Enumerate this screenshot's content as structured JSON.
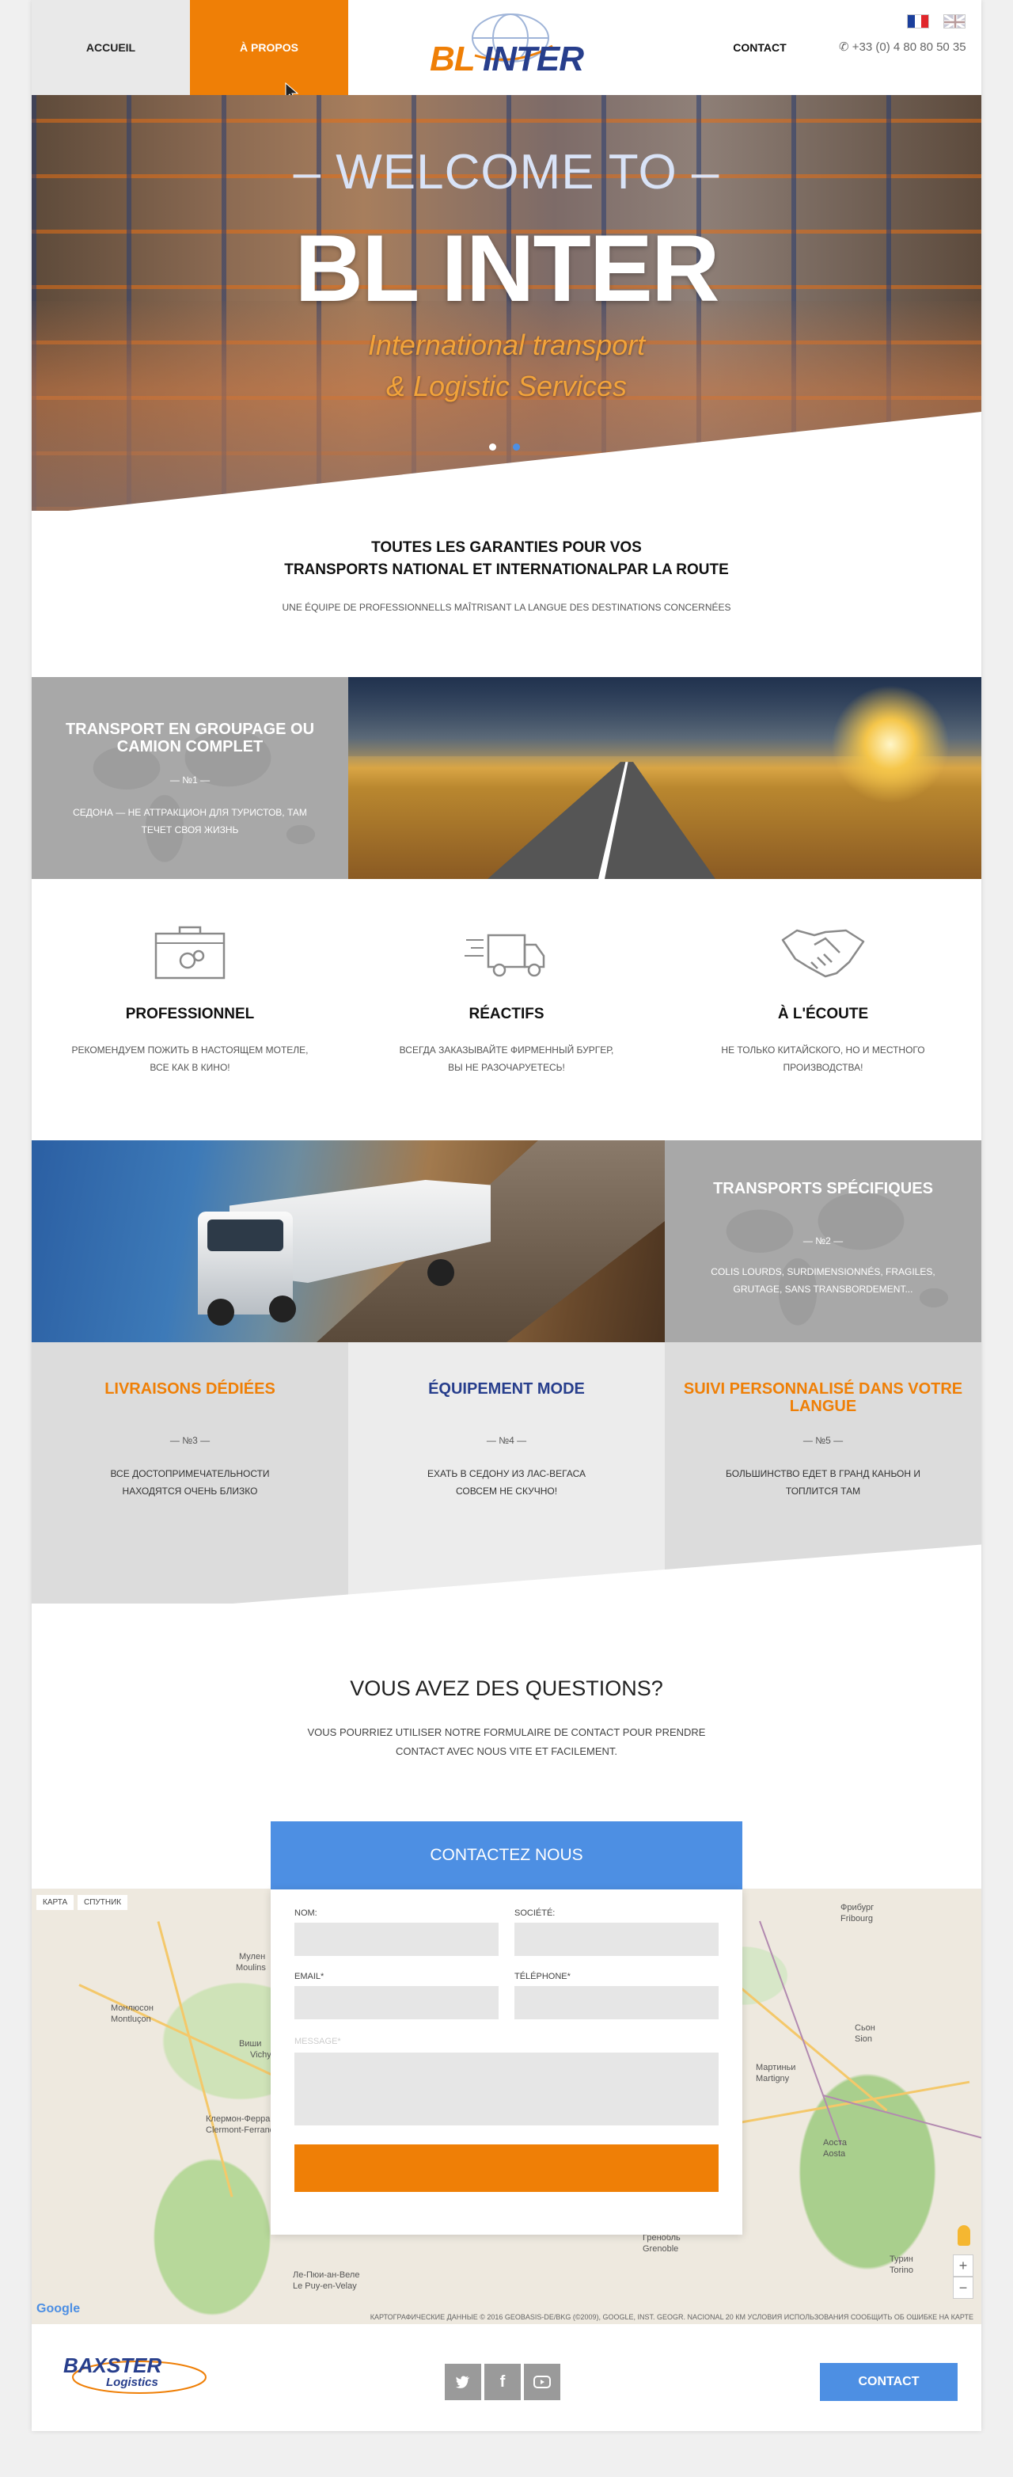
{
  "header": {
    "nav": [
      {
        "label": "ACCUEIL"
      },
      {
        "label": "À PROPOS"
      },
      {
        "label": "CONTACT"
      }
    ],
    "logo": {
      "part1": "BL",
      "part2": "INTER"
    },
    "phone": "+33 (0) 4 80 80 50 35",
    "languages": [
      "fr-flag-icon",
      "en-flag-icon"
    ]
  },
  "hero": {
    "welcome": "– WELCOME TO –",
    "title": "BL INTER",
    "subtitle_line1": "International transport",
    "subtitle_line2": "& Logistic Services",
    "slide_count": 2,
    "active_slide": 1
  },
  "intro": {
    "title_line1": "TOUTES LES GARANTIES POUR VOS",
    "title_line2": "TRANSPORTS  NATIONAL ET INTERNATIONALPAR LA ROUTE",
    "subtitle": "UNE ÉQUIPE DE PROFESSIONNELLS MAÎTRISANT LA LANGUE DES DESTINATIONS CONCERNÉES"
  },
  "services": [
    {
      "title": "TRANSPORT EN GROUPAGE OU CAMION COMPLET",
      "num": "— №1 —",
      "text": "СЕДОНА — НЕ АТТРАКЦИОН ДЛЯ ТУРИСТОВ, ТАМ ТЕЧЕТ СВОЯ ЖИЗНЬ"
    },
    {
      "title": "TRANSPORTS SPÉCIFIQUES",
      "num": "— №2 —",
      "text": "COLIS LOURDS, SURDIMENSIONNÉS, FRAGILES, GRUTAGE, SANS TRANSBORDEMENT..."
    },
    {
      "title": "LIVRAISONS DÉDIÉES",
      "num": "— №3 —",
      "text": "ВСЕ ДОСТОПРИМЕЧАТЕЛЬНОСТИ НАХОДЯТСЯ ОЧЕНЬ БЛИЗКО"
    },
    {
      "title": "ÉQUIPEMENT MODE",
      "num": "— №4 —",
      "text": "ЕХАТЬ В СЕДОНУ ИЗ ЛАС-ВЕГАСА СОВСЕМ НЕ СКУЧНО!"
    },
    {
      "title": "SUIVI PERSONNALISÉ DANS VOTRE LANGUE",
      "num": "— №5 —",
      "text": "БОЛЬШИНСТВО ЕДЕТ В ГРАНД КАНЬОН И ТОПЛИТСЯ ТАМ"
    }
  ],
  "features": [
    {
      "icon": "toolbox-gears-icon",
      "title": "PROFESSIONNEL",
      "text_line1": "РЕКОМЕНДУЕМ ПОЖИТЬ В НАСТОЯЩЕМ МОТЕЛЕ,",
      "text_line2": "ВСЕ КАК В КИНО!"
    },
    {
      "icon": "fast-truck-icon",
      "title": "RÉACTIFS",
      "text_line1": "ВСЕГДА ЗАКАЗЫВАЙТЕ ФИРМЕННЫЙ БУРГЕР,",
      "text_line2": "ВЫ НЕ РАЗОЧАРУЕТЕСЬ!"
    },
    {
      "icon": "handshake-icon",
      "title": "À L'ÉCOUTE",
      "text_line1": "НЕ ТОЛЬКО КИТАЙСКОГО, НО И МЕСТНОГО",
      "text_line2": "ПРОИЗВОДСТВА!"
    }
  ],
  "questions": {
    "title": "VOUS AVEZ DES QUESTIONS?",
    "text_line1": "VOUS POURRIEZ UTILISER NOTRE FORMULAIRE DE CONTACT POUR PRENDRE",
    "text_line2": "CONTACT AVEC NOUS VITE ET FACILEMENT."
  },
  "map": {
    "tab_map": "КАРТА",
    "tab_satellite": "СПУТНИК",
    "labels": [
      "Мулен",
      "Moulins",
      "Клермон-Ферран",
      "Clermont-Ferrand",
      "Гренобль",
      "Grenoble",
      "Фрибург",
      "Fribourg",
      "Сьон",
      "Sion",
      "Турин",
      "Torino",
      "Аоста",
      "Aosta",
      "Монлюсон",
      "Montluçon",
      "Виши",
      "Vichy",
      "Ле-Пюи-ан-Веле",
      "Le Puy-en-Velay",
      "Мартиньи",
      "Martigny"
    ],
    "zoom_in": "+",
    "zoom_out": "−",
    "google": "Google",
    "footer": "КАРТОГРАФИЧЕСКИЕ ДАННЫЕ © 2016 GEOBASIS-DE/BKG (©2009), GOOGLE, INST. GEOGR. NACIONAL    20 КМ    УСЛОВИЯ ИСПОЛЬЗОВАНИЯ    СООБЩИТЬ ОБ ОШИБКЕ НА КАРТЕ"
  },
  "form": {
    "header": "CONTACTEZ NOUS",
    "nom_label": "NOM:",
    "societe_label": "SOCIÉTÉ:",
    "email_label": "EMAIL*",
    "telephone_label": "TÉLÉPHONE*",
    "message_label": "MESSAGE*",
    "submit_label": ""
  },
  "footer": {
    "logo_line1": "BAXSTER",
    "logo_line2": "Logistics",
    "social": [
      "twitter-icon",
      "facebook-icon",
      "youtube-icon"
    ],
    "contact_button": "CONTACT"
  },
  "colors": {
    "accent_orange": "#ef7f06",
    "brand_blue": "#273e8c",
    "button_blue": "#4d8fe3",
    "grey_block": "#a8a8a8"
  }
}
